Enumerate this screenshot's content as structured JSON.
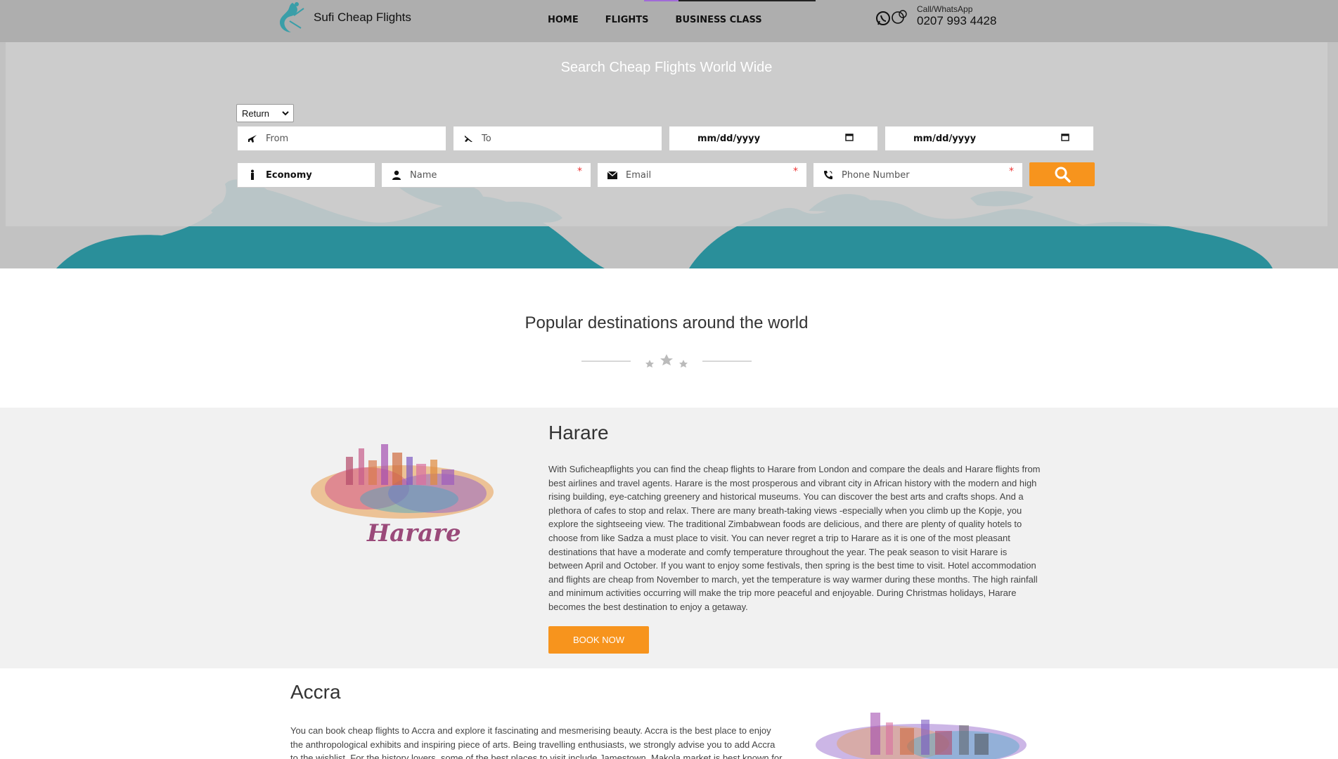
{
  "header": {
    "logo_text": "Sufi Cheap Flights",
    "nav": [
      "HOME",
      "FLIGHTS",
      "BUSINESS CLASS"
    ],
    "contact_label": "Call/WhatsApp",
    "contact_phone": "0207 993 4428"
  },
  "search": {
    "title": "Search Cheap Flights World Wide",
    "trip_type": "Return",
    "from_placeholder": "From",
    "to_placeholder": "To",
    "depart_date": "mm/dd/yyyy",
    "return_date": "mm/dd/yyyy",
    "cabin_class": "Economy",
    "name_placeholder": "Name",
    "email_placeholder": "Email",
    "phone_placeholder": "Phone Number",
    "required_mark": "*"
  },
  "popular": {
    "title": "Popular destinations around the world"
  },
  "destinations": [
    {
      "name": "Harare",
      "image_caption": "Harare",
      "text": "With Suficheapflights you can find the cheap flights to Harare from London and compare the deals and Harare flights from best airlines and travel agents. Harare is the most prosperous and vibrant city in African history with the modern and high rising building, eye-catching greenery and historical museums. You can discover the best arts and crafts shops. And a plethora of cafes to stop and relax. There are many breath-taking views -especially when you climb up the Kopje, you explore the sightseeing view. The traditional Zimbabwean foods are delicious, and there are plenty of quality hotels to choose from like Sadza a must place to visit. You can never regret a trip to Harare as it is one of the most pleasant destinations that have a moderate and comfy temperature throughout the year. The peak season to visit Harare is between April and October. If you want to enjoy some festivals, then spring is the best time to visit. Hotel accommodation and flights are cheap from November to march, yet the temperature is way warmer during these months. The high rainfall and minimum activities occurring will make the trip more peaceful and enjoyable. During Christmas holidays, Harare becomes the best destination to enjoy a getaway.",
      "button": "BOOK NOW"
    },
    {
      "name": "Accra",
      "text": "You can book cheap flights to Accra and explore it fascinating and mesmerising beauty. Accra is the best place to enjoy the anthropological exhibits and inspiring piece of arts. Being travelling enthusiasts, we strongly advise you to add Accra to the wishlist. For the history lovers, some of the best places to visit include Jamestown, Makola market is best known for"
    }
  ],
  "colors": {
    "accent": "#f7941d",
    "map_teal": "#2a8f9a",
    "nav_active": "#a16bd8"
  }
}
